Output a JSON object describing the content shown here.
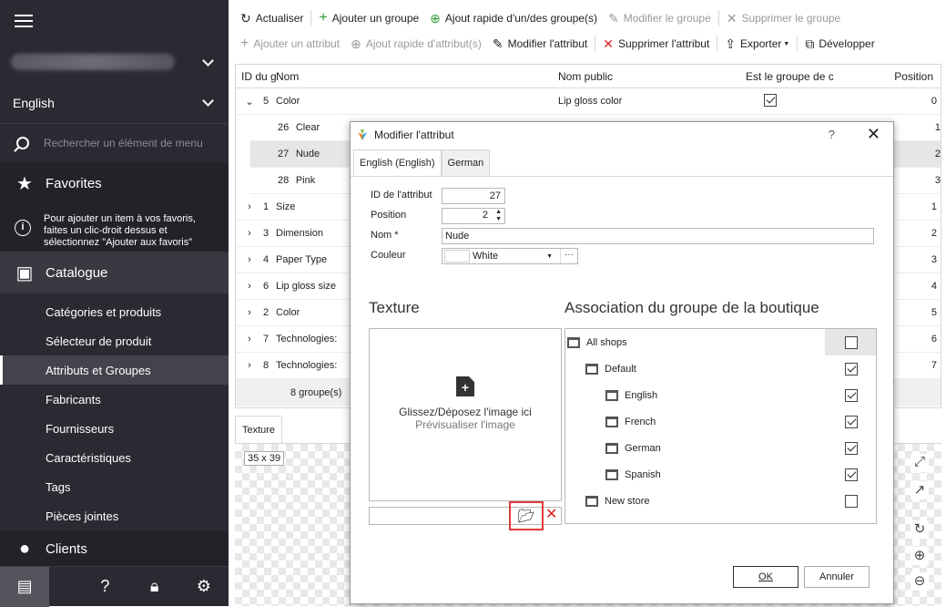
{
  "sidebar": {
    "language": "English",
    "search_placeholder": "Rechercher un élément de menu",
    "favorites_label": "Favorites",
    "favorites_note": "Pour ajouter un item à vos favoris, faites un clic-droit dessus et sélectionnez \"Ajouter aux favoris\"",
    "catalog_label": "Catalogue",
    "catalog_items": [
      "Catégories et produits",
      "Sélecteur de produit",
      "Attributs et Groupes",
      "Fabricants",
      "Fournisseurs",
      "Caractéristiques",
      "Tags",
      "Pièces jointes"
    ],
    "clients_label": "Clients"
  },
  "toolbar1": {
    "refresh": "Actualiser",
    "add_group": "Ajouter un groupe",
    "quick_add_group": "Ajout rapide d'un/des groupe(s)",
    "edit_group": "Modifier le groupe",
    "delete_group": "Supprimer le groupe"
  },
  "toolbar2": {
    "add_attribute": "Ajouter un attribut",
    "quick_add_attribute": "Ajout rapide d'attribut(s)",
    "edit_attribute": "Modifier l'attribut",
    "delete_attribute": "Supprimer l'attribut",
    "export": "Exporter",
    "expand": "Développer"
  },
  "grid": {
    "headers": {
      "id": "ID du g",
      "name": "Nom",
      "public_name": "Nom public",
      "is_group": "Est le groupe de c",
      "position": "Position"
    },
    "rows": [
      {
        "id": "5",
        "name": "Color",
        "public_name": "Lip gloss color",
        "position": "0"
      },
      {
        "id": "26",
        "name": "Clear",
        "position": "1"
      },
      {
        "id": "27",
        "name": "Nude",
        "position": "2"
      },
      {
        "id": "28",
        "name": "Pink",
        "position": "3"
      },
      {
        "id": "1",
        "name": "Size",
        "position": "1"
      },
      {
        "id": "3",
        "name": "Dimension",
        "position": "2"
      },
      {
        "id": "4",
        "name": "Paper Type",
        "position": "3"
      },
      {
        "id": "6",
        "name": "Lip gloss size",
        "position": "4"
      },
      {
        "id": "2",
        "name": "Color",
        "position": "5"
      },
      {
        "id": "7",
        "name": "Technologies:",
        "position": "6"
      },
      {
        "id": "8",
        "name": "Technologies:",
        "position": "7"
      }
    ],
    "footer": "8 groupe(s)"
  },
  "texture_panel": {
    "tab": "Texture",
    "size": "35 x 39"
  },
  "dialog": {
    "title": "Modifier l'attribut",
    "help": "?",
    "tabs": [
      "English (English)",
      "German"
    ],
    "fields": {
      "id_label": "ID de l'attribut",
      "id_value": "27",
      "position_label": "Position",
      "position_value": "2",
      "name_label": "Nom *",
      "name_value": "Nude",
      "color_label": "Couleur",
      "color_value": "White"
    },
    "texture_title": "Texture",
    "drop_text": "Glissez/Déposez l'image ici",
    "preview_text": "Prévisualiser l'image",
    "shop_title": "Association du groupe de la boutique",
    "shops": [
      {
        "name": "All shops",
        "checked": false
      },
      {
        "name": "Default",
        "checked": true
      },
      {
        "name": "English",
        "checked": true
      },
      {
        "name": "French",
        "checked": true
      },
      {
        "name": "German",
        "checked": true
      },
      {
        "name": "Spanish",
        "checked": true
      },
      {
        "name": "New store",
        "checked": false
      }
    ],
    "ok": "OK",
    "cancel": "Annuler"
  },
  "colors": {
    "sidebar": "#2b2a33",
    "accent_green": "#2e9d3a",
    "delete_red": "#e02020"
  }
}
